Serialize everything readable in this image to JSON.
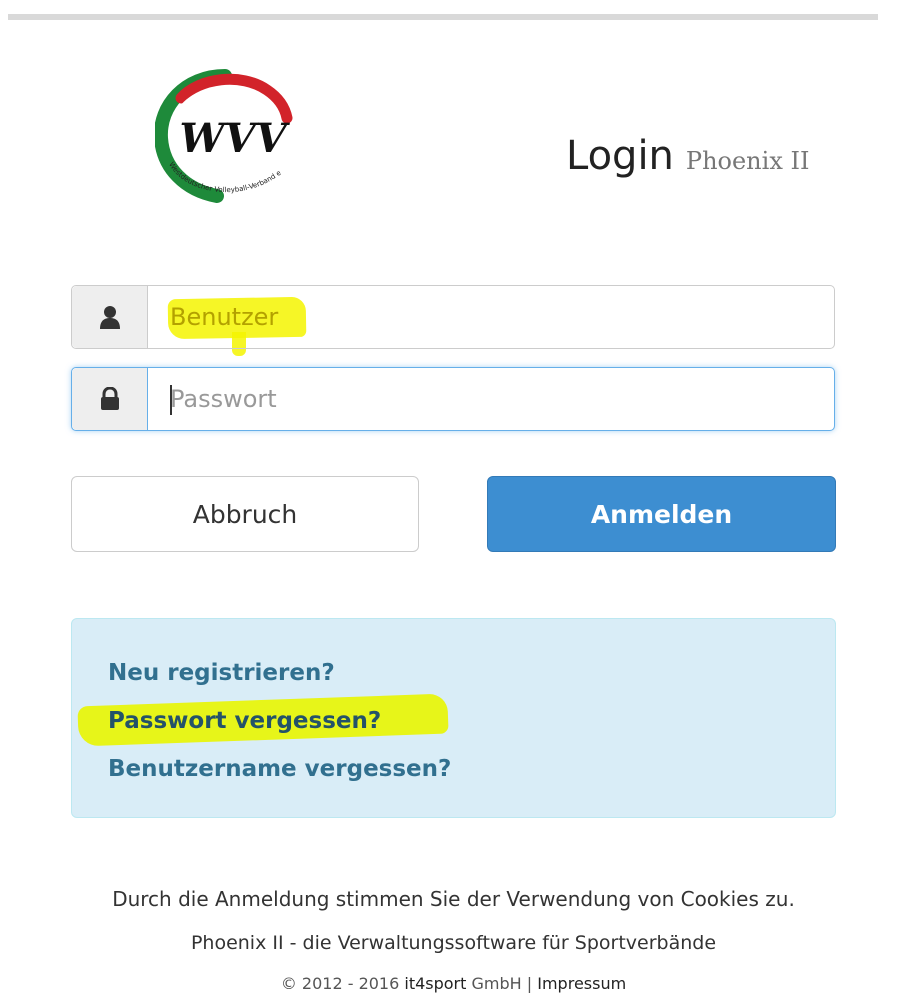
{
  "header": {
    "title": "Login",
    "subtitle": "Phoenix II",
    "logo_text": "WVV",
    "logo_subtext": "Westdeutscher Volleyball-Verband e.V."
  },
  "form": {
    "username": {
      "placeholder": "Benutzer",
      "value": "",
      "icon": "user-icon"
    },
    "password": {
      "placeholder": "Passwort",
      "value": "",
      "icon": "lock-icon"
    },
    "cancel_label": "Abbruch",
    "submit_label": "Anmelden"
  },
  "links": [
    {
      "label": "Neu registrieren?"
    },
    {
      "label": "Passwort vergessen?"
    },
    {
      "label": "Benutzername vergessen?"
    }
  ],
  "footer": {
    "cookies_notice": "Durch die Anmeldung stimmen Sie der Verwendung von Cookies zu.",
    "tagline": "Phoenix II - die Verwaltungssoftware für Sportverbände",
    "copyright_prefix": "© 2012 - 2016",
    "company_brand": "it4sport",
    "company_suffix": "GmbH",
    "separator": "|",
    "impressum": "Impressum"
  },
  "colors": {
    "primary": "#3d8ed1",
    "info_bg": "#d9edf7",
    "link": "#31708f",
    "highlight": "#f5f500",
    "logo_green": "#1e8a3a",
    "logo_red": "#d2232a"
  }
}
